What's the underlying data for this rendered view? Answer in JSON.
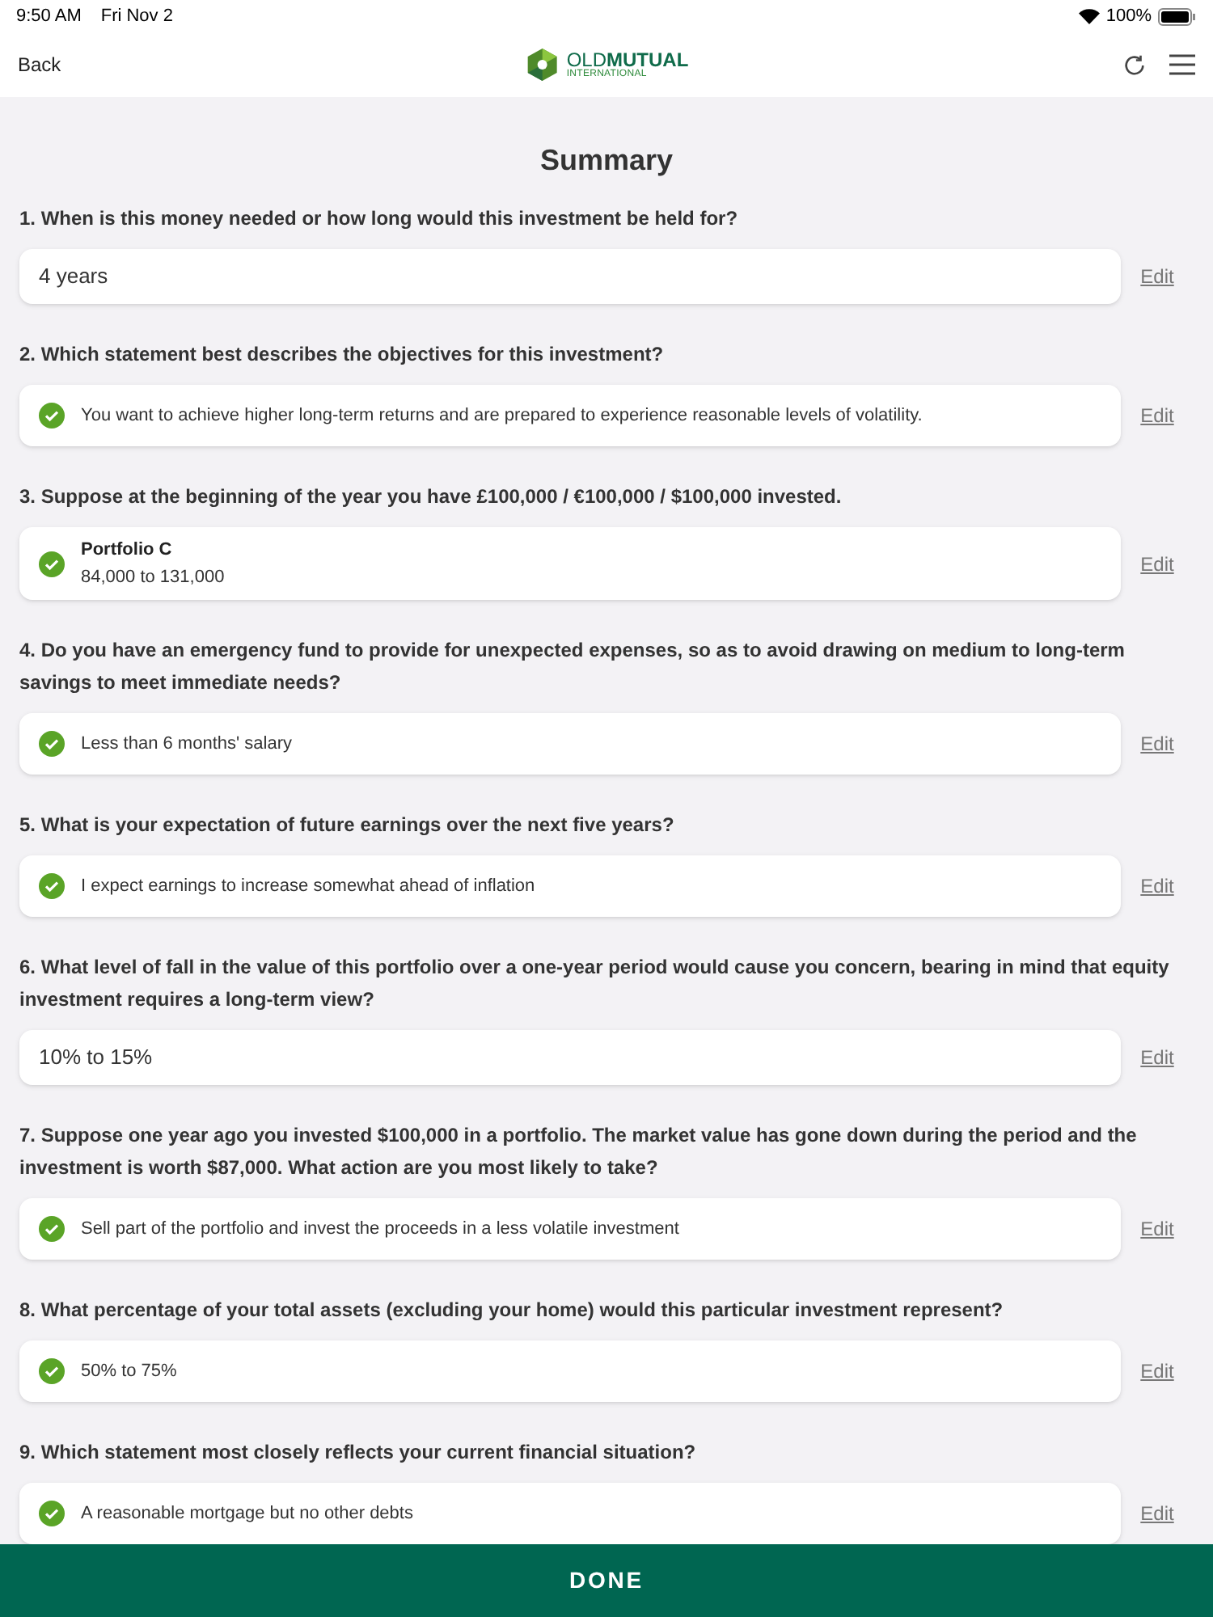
{
  "status_bar": {
    "time": "9:50 AM",
    "date": "Fri Nov 2",
    "battery": "100%"
  },
  "nav": {
    "back": "Back",
    "logo_bold": "MUTUAL",
    "logo_light": "OLD",
    "logo_sub": "INTERNATIONAL"
  },
  "title": "Summary",
  "questions": [
    {
      "question": "1. When is this money needed or how long would this investment be held for?",
      "answer": {
        "kind": "text",
        "text": "4 years"
      },
      "edit": "Edit"
    },
    {
      "question": "2. Which statement best describes the objectives for this investment?",
      "answer": {
        "kind": "option",
        "text": "You want to achieve higher long-term returns and are prepared to experience reasonable levels of volatility."
      },
      "edit": "Edit"
    },
    {
      "question": "3. Suppose at the beginning of the year you have £100,000 / €100,000 / $100,000 invested.",
      "answer": {
        "kind": "option",
        "title": "Portfolio C",
        "text": "84,000 to 131,000"
      },
      "edit": "Edit"
    },
    {
      "question": "4. Do you have an emergency fund to provide for unexpected expenses, so as to avoid drawing on medium to long-term savings to meet immediate needs?",
      "answer": {
        "kind": "option",
        "text": "Less than 6 months' salary"
      },
      "edit": "Edit"
    },
    {
      "question": "5. What is your expectation of future earnings over the next five years?",
      "answer": {
        "kind": "option",
        "text": "I expect earnings to increase somewhat ahead of inflation"
      },
      "edit": "Edit"
    },
    {
      "question": "6. What level of fall in the value of this portfolio over a one-year period would cause you concern, bearing in mind that equity investment requires a long-term view?",
      "answer": {
        "kind": "text",
        "text": "10% to 15%"
      },
      "edit": "Edit"
    },
    {
      "question": "7. Suppose one year ago you invested $100,000 in a portfolio. The market value has gone down during the period and the investment is worth $87,000. What action are you most likely to take?",
      "answer": {
        "kind": "option",
        "text": "Sell part of the portfolio and invest the proceeds in a less volatile investment"
      },
      "edit": "Edit"
    },
    {
      "question": "8. What percentage of your total assets (excluding your home) would this particular investment represent?",
      "answer": {
        "kind": "option",
        "text": "50% to 75%"
      },
      "edit": "Edit"
    },
    {
      "question": "9. Which statement most closely reflects your current financial situation?",
      "answer": {
        "kind": "option",
        "text": "A reasonable mortgage but no other debts"
      },
      "edit": "Edit"
    }
  ],
  "done": "DONE"
}
